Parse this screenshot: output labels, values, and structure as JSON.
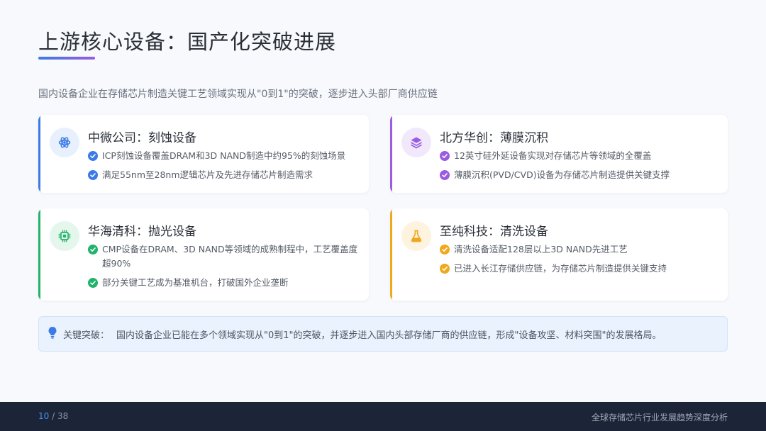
{
  "page": {
    "title": "上游核心设备：国产化突破进展",
    "subtitle": "国内设备企业在存储芯片制造关键工艺领域实现从\"0到1\"的突破，逐步进入头部厂商供应链"
  },
  "cards": [
    {
      "title": "中微公司：刻蚀设备",
      "icon": "atom-icon",
      "accent": "#3b7be8",
      "soft": "#e8f0fd",
      "items": [
        "ICP刻蚀设备覆盖DRAM和3D NAND制造中约95%的刻蚀场景",
        "满足55nm至28nm逻辑芯片及先进存储芯片制造需求"
      ]
    },
    {
      "title": "北方华创：薄膜沉积",
      "icon": "layers-icon",
      "accent": "#9a5ce0",
      "soft": "#f1e9fb",
      "items": [
        "12英寸硅外延设备实现对存储芯片等领域的全覆盖",
        "薄膜沉积(PVD/CVD)设备为存储芯片制造提供关键支撑"
      ]
    },
    {
      "title": "华海清科：抛光设备",
      "icon": "chip-icon",
      "accent": "#22b36a",
      "soft": "#e5f6ed",
      "items": [
        "CMP设备在DRAM、3D NAND等领域的成熟制程中，工艺覆盖度超90%",
        "部分关键工艺成为基准机台，打破国外企业垄断"
      ]
    },
    {
      "title": "至纯科技：清洗设备",
      "icon": "flask-icon",
      "accent": "#f0a81c",
      "soft": "#fdf3df",
      "items": [
        "清洗设备适配128层以上3D NAND先进工艺",
        "已进入长江存储供应链，为存储芯片制造提供关键支持"
      ]
    }
  ],
  "callout": {
    "icon": "lightbulb-icon",
    "label": "关键突破：",
    "text": "国内设备企业已能在多个领域实现从\"0到1\"的突破，并逐步进入国内头部存储厂商的供应链，形成\"设备攻坚、材料突围\"的发展格局。"
  },
  "footer": {
    "current_page": "10",
    "total_pages": "/ 38",
    "title": "全球存储芯片行业发展趋势深度分析"
  }
}
